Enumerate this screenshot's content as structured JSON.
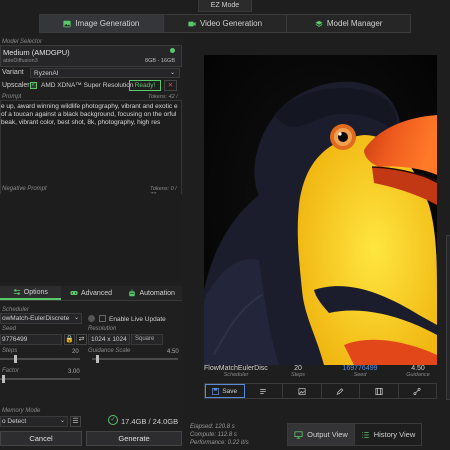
{
  "header": {
    "ez_mode": "EZ Mode"
  },
  "tabs": [
    {
      "label": "Image Generation",
      "icon": "image-icon",
      "active": true
    },
    {
      "label": "Video Generation",
      "icon": "video-icon",
      "active": false
    },
    {
      "label": "Model Manager",
      "icon": "layers-icon",
      "active": false
    }
  ],
  "model_selector": {
    "label": "Model Selector",
    "model_name": "Medium (AMDGPU)",
    "model_sub": "ableDiffusion3",
    "model_size": "8GB - 16GB",
    "status_color": "#59c86a",
    "variant_label": "Variant",
    "variant_value": "RyzenAI"
  },
  "upscaler": {
    "label": "Upscaler",
    "option": "AMD XDNA™ Super Resolution",
    "status": "Ready!",
    "close": "✕"
  },
  "prompt": {
    "label": "Prompt",
    "tokens": "Tokens: 42 / 77",
    "text": "e up, award winning wildlife photography, vibrant and exotic e of a toucan against a black background, focusing on the orful beak, vibrant color, best shot, 8k, photography, high res"
  },
  "negative_prompt": {
    "label": "Negative Prompt",
    "tokens": "Tokens: 0 / 77"
  },
  "subtabs": [
    {
      "label": "Options",
      "icon": "sliders-icon",
      "active": true
    },
    {
      "label": "Advanced",
      "icon": "gamepad-icon",
      "active": false
    },
    {
      "label": "Automation",
      "icon": "robot-icon",
      "active": false
    }
  ],
  "options": {
    "scheduler_label": "Scheduler",
    "scheduler_value": "owMatch-EulerDiscrete",
    "live_update_label": "Enable Live Update",
    "seed_label": "Seed",
    "seed_value": "9776499",
    "resolution_label": "Resolution",
    "resolution_value": "1024 x 1024",
    "resolution_shape": "Square",
    "steps_label": "Steps",
    "steps_value": "20",
    "guidance_label": "Guidance Scale",
    "guidance_value": "4.50",
    "steps_fraction": 0.18,
    "guidance_fraction": 0.05,
    "scale_label": "Factor",
    "scale_value": "3.00",
    "scale_fraction": 0.02,
    "memory_label": "Memory Mode",
    "memory_value": "o Detect",
    "memory_usage": "17.4GB / 24.0GB"
  },
  "buttons": {
    "cancel": "Cancel",
    "generate": "Generate"
  },
  "output": {
    "scheduler_value": "FlowMatchEulerDisc",
    "scheduler_key": "Scheduler",
    "steps_value": "20",
    "steps_key": "Steps",
    "seed_value": "169776499",
    "seed_key": "Seed",
    "guidance_value": "4.50",
    "guidance_key": "Guidance",
    "seed_color": "#5b8fe0"
  },
  "actions": [
    {
      "label": "Save",
      "icon": "save-icon",
      "active": true
    },
    {
      "label": "",
      "icon": "list-icon",
      "active": false
    },
    {
      "label": "",
      "icon": "image-icon",
      "active": false
    },
    {
      "label": "",
      "icon": "edit-icon",
      "active": false
    },
    {
      "label": "",
      "icon": "film-icon",
      "active": false
    },
    {
      "label": "",
      "icon": "nodes-icon",
      "active": false
    }
  ],
  "stats": {
    "elapsed": "Elapsed: 120.8 s",
    "compute": "Compute: 112.8 s",
    "performance": "Performance: 0.22 it/s"
  },
  "views": {
    "output": "Output View",
    "history": "History View"
  }
}
